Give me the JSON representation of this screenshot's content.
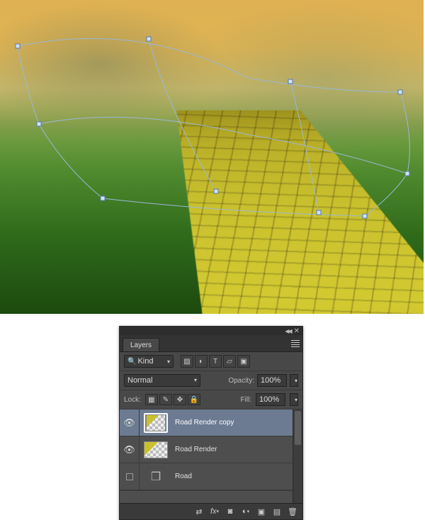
{
  "panel": {
    "title": "Layers",
    "filter_label": "Kind",
    "blend_mode": "Normal",
    "opacity_label": "Opacity:",
    "opacity_value": "100%",
    "lock_label": "Lock:",
    "fill_label": "Fill:",
    "fill_value": "100%",
    "filter_icons": [
      "image-icon",
      "adjustment-icon",
      "type-icon",
      "shape-icon",
      "smartobject-icon"
    ],
    "lock_icons": [
      "lock-transparency-icon",
      "lock-paint-icon",
      "lock-position-icon",
      "lock-all-icon"
    ],
    "bottom_icons": [
      "link-icon",
      "fx-icon",
      "mask-icon",
      "adjustment-layer-icon",
      "group-icon",
      "new-layer-icon",
      "trash-icon"
    ]
  },
  "layers": [
    {
      "visible": true,
      "selected": true,
      "kind": "render",
      "name": "Road Render copy"
    },
    {
      "visible": true,
      "selected": false,
      "kind": "render",
      "name": "Road Render"
    },
    {
      "visible": false,
      "selected": false,
      "kind": "3d",
      "name": "Road"
    }
  ]
}
